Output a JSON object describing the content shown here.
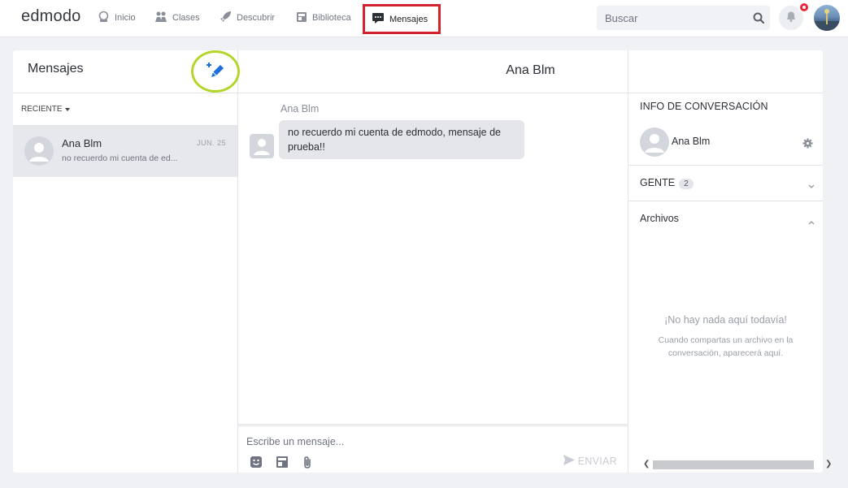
{
  "app": {
    "logo": "edmodo"
  },
  "nav": {
    "items": [
      {
        "label": "Inicio",
        "icon": "home-icon"
      },
      {
        "label": "Clases",
        "icon": "classes-icon"
      },
      {
        "label": "Descubrir",
        "icon": "rocket-icon"
      },
      {
        "label": "Biblioteca",
        "icon": "library-icon"
      },
      {
        "label": "Mensajes",
        "icon": "message-icon",
        "active": true
      }
    ],
    "search_placeholder": "Buscar",
    "notification_badge_color": "#e8283b"
  },
  "sidebar": {
    "title": "Mensajes",
    "compose_icon": "compose-message-icon",
    "filter_label": "RECIENTE",
    "conversations": [
      {
        "name": "Ana Blm",
        "date": "JUN. 25",
        "preview": "no recuerdo mi cuenta de ed..."
      }
    ]
  },
  "chat": {
    "title": "Ana Blm",
    "messages": [
      {
        "sender": "Ana Blm",
        "text": "no recuerdo mi cuenta de edmodo, mensaje de prueba!!"
      }
    ],
    "composer": {
      "placeholder": "Escribe un mensaje...",
      "send_label": "ENVIAR"
    }
  },
  "info": {
    "title": "INFO DE CONVERSACIÓN",
    "user_name": "Ana Blm",
    "people_label": "GENTE",
    "people_count": "2",
    "files_label": "Archivos",
    "empty_title": "¡No hay nada aquí todavía!",
    "empty_desc": "Cuando compartas un archivo en la conversación, aparecerá aquí."
  },
  "colors": {
    "accent_blue": "#1e6fd9",
    "highlight_red": "#d1222e",
    "highlight_green": "#b4d62a"
  }
}
